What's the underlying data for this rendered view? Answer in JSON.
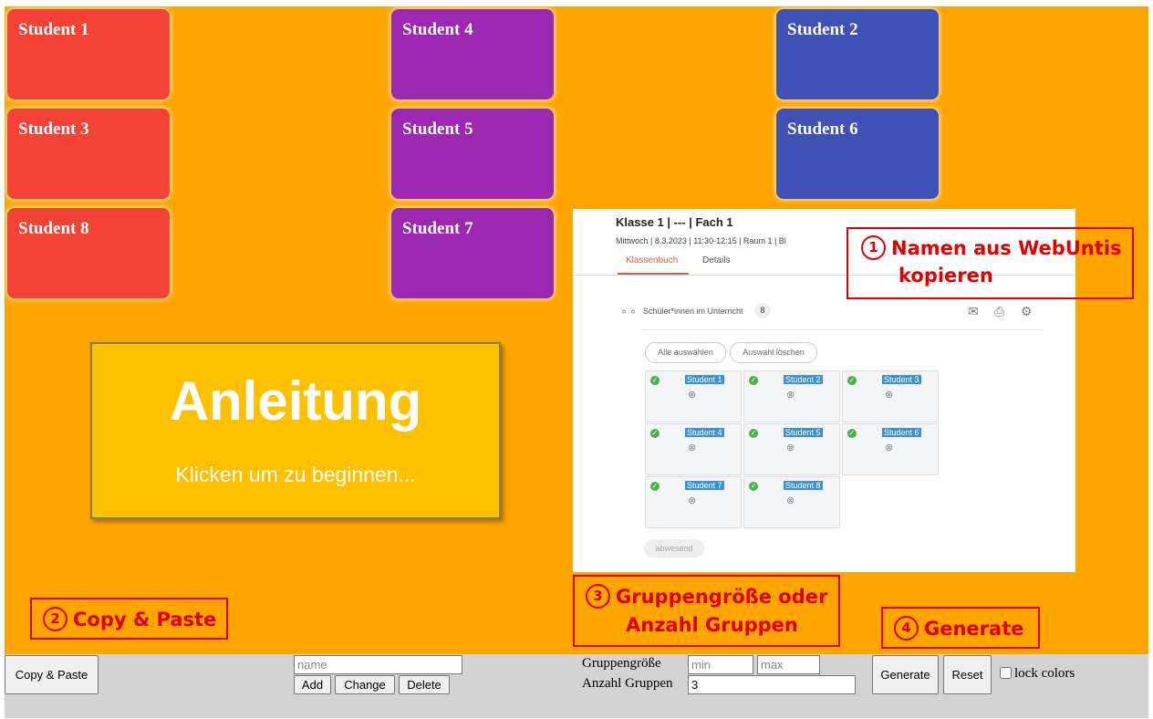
{
  "cards": [
    {
      "label": "Student 1",
      "color": "#f44336"
    },
    {
      "label": "Student 4",
      "color": "#9c27b0"
    },
    {
      "label": "Student 2",
      "color": "#3f51b5"
    },
    {
      "label": "Student 3",
      "color": "#f44336"
    },
    {
      "label": "Student 5",
      "color": "#9c27b0"
    },
    {
      "label": "Student 6",
      "color": "#3f51b5"
    },
    {
      "label": "Student 8",
      "color": "#f44336"
    },
    {
      "label": "Student 7",
      "color": "#9c27b0"
    }
  ],
  "anleitung": {
    "title": "Anleitung",
    "subtitle": "Klicken um zu beginnen..."
  },
  "webuntis": {
    "title": "Klasse 1 | --- | Fach 1",
    "meta": "Mittwoch  |  8.3.2023  |  11:30-12:15  |  Raum 1  |  Bl",
    "tab_klassenbuch": "Klassenbuch",
    "tab_details": "Details",
    "schueler_label": "Schüler*innen im Unterricht",
    "schueler_count": "8",
    "btn_alle": "Alle auswählen",
    "btn_loeschen": "Auswahl löschen",
    "students": [
      "Student 1",
      "Student 2",
      "Student 3",
      "Student 4",
      "Student 5",
      "Student 6",
      "Student 7",
      "Student 8"
    ],
    "abwesend": "abwesend"
  },
  "callouts": {
    "step1_num": "1",
    "step1_line1": "Namen aus WebUntis",
    "step1_line2": "kopieren",
    "step2_num": "2",
    "step2": "Copy & Paste",
    "step3_num": "3",
    "step3_line1": "Gruppengröße oder",
    "step3_line2": "Anzahl Gruppen",
    "step4_num": "4",
    "step4": "Generate"
  },
  "toolbar": {
    "copy_paste": "Copy & Paste",
    "name_placeholder": "name",
    "add": "Add",
    "change": "Change",
    "delete": "Delete",
    "gruppengroesse_label": "Gruppengröße",
    "min_placeholder": "min",
    "max_placeholder": "max",
    "anzahl_label": "Anzahl Gruppen",
    "anzahl_value": "3",
    "generate": "Generate",
    "reset": "Reset",
    "lock_colors": "lock colors"
  }
}
